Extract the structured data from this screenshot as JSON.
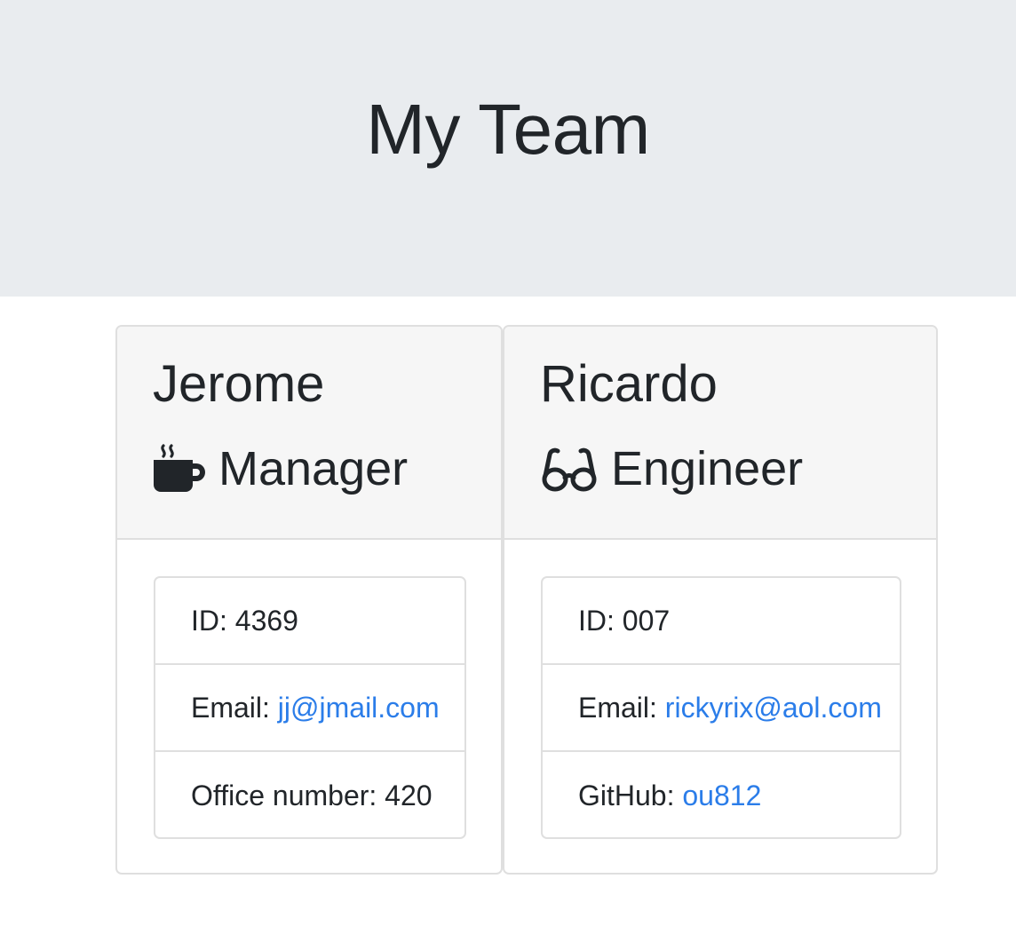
{
  "page": {
    "title": "My Team"
  },
  "team": [
    {
      "name": "Jerome",
      "role": "Manager",
      "role_icon": "mug-hot-icon",
      "id_label": "ID: ",
      "id": "4369",
      "email_label": "Email: ",
      "email": "jj@jmail.com",
      "extra_label": "Office number: ",
      "extra_value": "420"
    },
    {
      "name": "Ricardo",
      "role": "Engineer",
      "role_icon": "glasses-icon",
      "id_label": "ID: ",
      "id": "007",
      "email_label": "Email: ",
      "email": "rickyrix@aol.com",
      "extra_label": "GitHub: ",
      "extra_value": "ou812"
    }
  ],
  "colors": {
    "jumbotron_bg": "#e9ecef",
    "card_header_bg": "#f6f6f6",
    "link": "#2b7de9",
    "text": "#212529"
  }
}
